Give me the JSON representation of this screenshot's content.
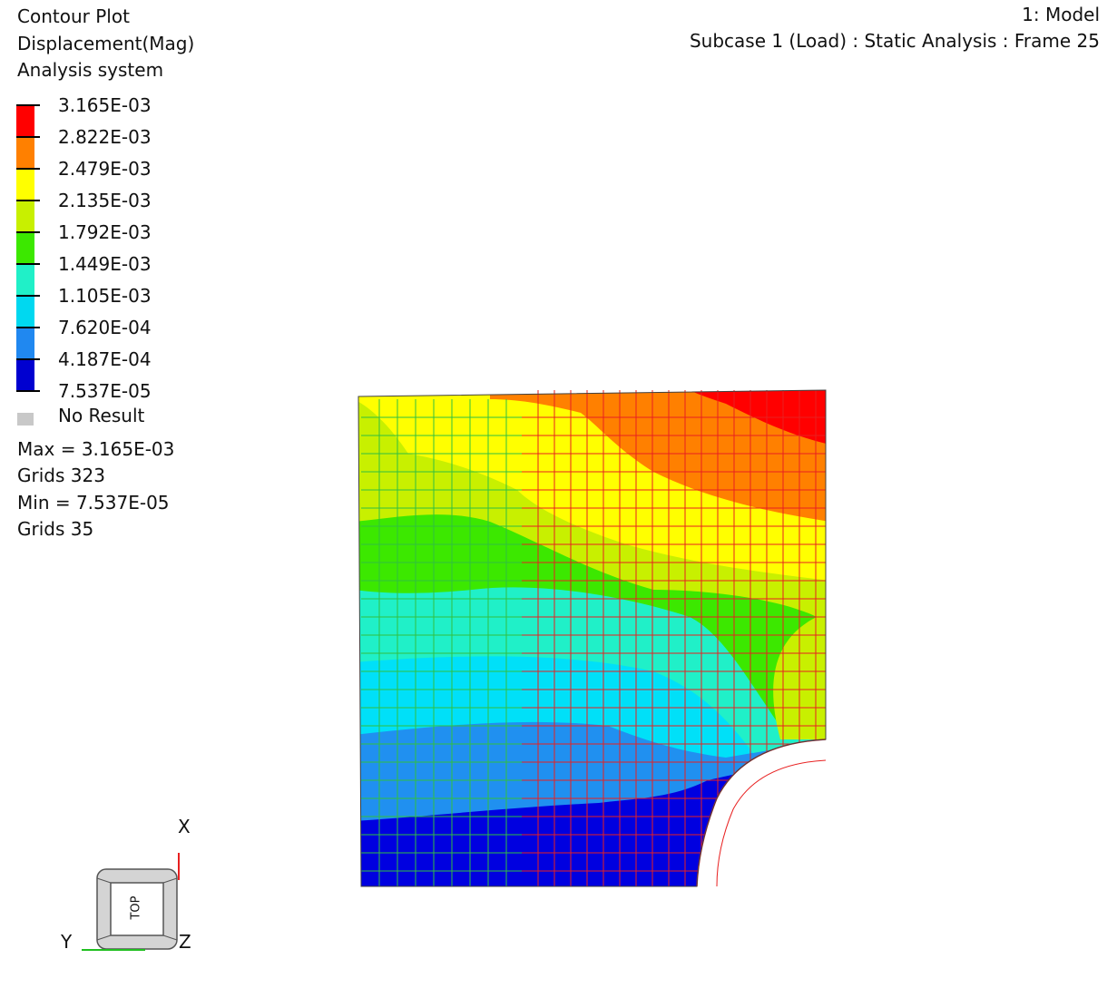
{
  "header": {
    "plot_type": "Contour Plot",
    "result_type": "Displacement(Mag)",
    "coord_system": "Analysis system",
    "model_label": "1: Model",
    "subcase_label": "Subcase 1 (Load) : Static Analysis : Frame 25"
  },
  "legend": {
    "levels": [
      {
        "label": "3.165E-03",
        "color": "#ff0000"
      },
      {
        "label": "2.822E-03",
        "color": "#ff8000"
      },
      {
        "label": "2.479E-03",
        "color": "#ffd000"
      },
      {
        "label": "2.135E-03",
        "color": "#c8f000"
      },
      {
        "label": "1.792E-03",
        "color": "#3cdc00"
      },
      {
        "label": "1.449E-03",
        "color": "#20f0c0"
      },
      {
        "label": "1.105E-03",
        "color": "#00c8e8"
      },
      {
        "label": "7.620E-04",
        "color": "#2080f0"
      },
      {
        "label": "4.187E-04",
        "color": "#0000d0"
      },
      {
        "label": "7.537E-05",
        "color": "#000000"
      }
    ],
    "no_result_label": "No Result",
    "no_result_color": "#c8c8c8"
  },
  "stats": {
    "max_line": "Max =  3.165E-03",
    "max_grids": "Grids 323",
    "min_line": "Min =  7.537E-05",
    "min_grids": "Grids 35"
  },
  "triad": {
    "x_label": "X",
    "y_label": "Y",
    "z_label": "Z",
    "cube_face": "TOP"
  },
  "colors": {
    "band_red": "#ff0000",
    "band_orange": "#ff8000",
    "band_yellow": "#ffff00",
    "band_yellowgreen": "#c8f000",
    "band_green": "#3ce800",
    "band_aqua": "#20f0c8",
    "band_cyan": "#00e0f8",
    "band_lightblue": "#2090f0",
    "band_blue": "#0000e0",
    "mesh_red": "#e82020",
    "mesh_green": "#30c040"
  }
}
